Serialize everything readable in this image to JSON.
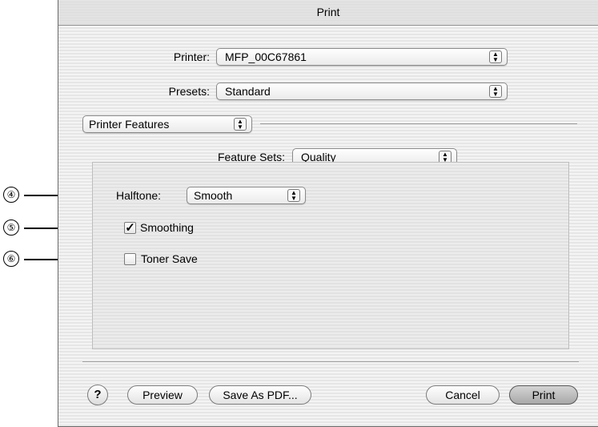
{
  "window": {
    "title": "Print"
  },
  "printer": {
    "label": "Printer:",
    "value": "MFP_00C67861"
  },
  "presets": {
    "label": "Presets:",
    "value": "Standard"
  },
  "panel_selector": {
    "value": "Printer Features"
  },
  "feature_sets": {
    "label": "Feature Sets:",
    "value": "Quality"
  },
  "halftone": {
    "label": "Halftone:",
    "value": "Smooth"
  },
  "smoothing": {
    "label": "Smoothing",
    "checked": true
  },
  "toner_save": {
    "label": "Toner Save",
    "checked": false
  },
  "callouts": [
    "④",
    "⑤",
    "⑥"
  ],
  "buttons": {
    "help": "?",
    "preview": "Preview",
    "save_as_pdf": "Save As PDF...",
    "cancel": "Cancel",
    "print": "Print"
  },
  "icons": {
    "popup_arrows": "up-down-arrows-icon",
    "checkmark": "checkmark-icon",
    "help": "help-icon"
  }
}
